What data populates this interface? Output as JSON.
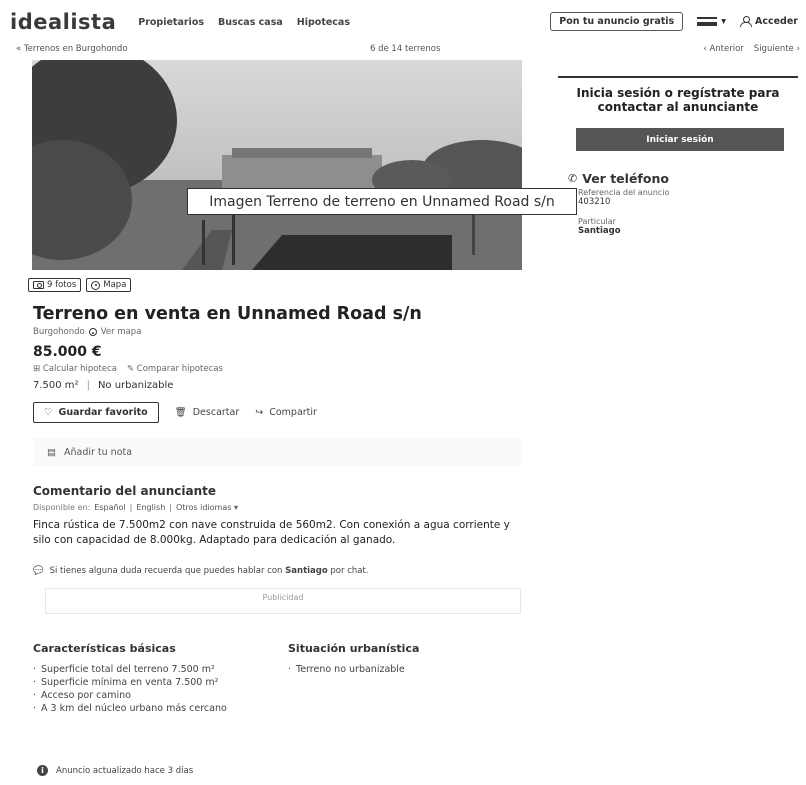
{
  "header": {
    "logo": "idealista",
    "nav": [
      "Propietarios",
      "Buscas casa",
      "Hipotecas"
    ],
    "publish_label": "Pon tu anuncio gratis",
    "menu_icon": "hamburger-icon",
    "login_label": "Acceder"
  },
  "subnav": {
    "back_label": "Terrenos en Burgohondo",
    "counter": "6 de 14 terrenos",
    "prev_label": "Anterior",
    "next_label": "Siguiente"
  },
  "photo": {
    "caption": "Imagen Terreno de terreno en  Unnamed Road s/n"
  },
  "contact": {
    "title": "Inicia sesión o regístrate para contactar al anunciante",
    "login_button": "Iniciar sesión",
    "phone_label": "Ver teléfono",
    "ref_label": "Referencia del anuncio",
    "ref_value": "403210",
    "advertiser_label": "Particular",
    "advertiser_name": "Santiago"
  },
  "media": {
    "photos_label": "9 fotos",
    "map_label": "Mapa"
  },
  "listing": {
    "title": "Terreno en venta en Unnamed Road s/n",
    "location": "Burgohondo",
    "map_link": "Ver mapa",
    "price": "85.000 €",
    "mortgage_calc": "Calcular hipoteca",
    "compare_mortgage": "Comparar hipotecas",
    "area": "7.500 m²",
    "zoning": "No urbanizable",
    "fav_label": "Guardar favorito",
    "discard_label": "Descartar",
    "share_label": "Compartir",
    "note_label": "Añadir tu nota"
  },
  "comment": {
    "title": "Comentario del anunciante",
    "available_in": "Disponible en:",
    "lang_es": "Español",
    "lang_en": "English",
    "other_langs": "Otros idiomas",
    "text": "Finca rústica de 7.500m2 con nave construida de 560m2. Con conexión a agua corriente y silo con capacidad de 8.000kg. Adaptado para dedicación al ganado.",
    "chat_prefix": "Si tienes alguna duda recuerda que puedes hablar con",
    "chat_name": "Santiago",
    "chat_suffix": "por chat.",
    "ad_label": "Publicidad"
  },
  "features": {
    "basic_title": "Características básicas",
    "basic_items": [
      "Superficie total del terreno 7.500 m²",
      "Superficie mínima en venta 7.500 m²",
      "Acceso por camino",
      "A 3 km del núcleo urbano más cercano"
    ],
    "urban_title": "Situación urbanística",
    "urban_items": [
      "Terreno no urbanizable"
    ]
  },
  "updated": "Anuncio actualizado hace 3 días"
}
